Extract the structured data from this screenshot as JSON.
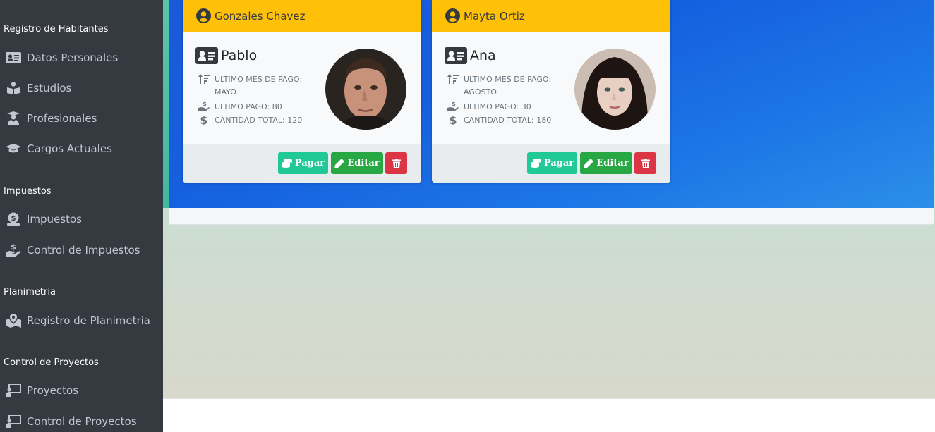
{
  "sidebar": {
    "sections": [
      {
        "header": "Registro de Habitantes",
        "items": [
          {
            "label": "Datos Personales",
            "icon": "id-card-icon"
          },
          {
            "label": "Estudios",
            "icon": "book-reader-icon"
          },
          {
            "label": "Profesionales",
            "icon": "user-graduate-icon"
          },
          {
            "label": "Cargos Actuales",
            "icon": "graduation-cap-icon"
          }
        ]
      },
      {
        "header": "Impuestos",
        "items": [
          {
            "label": "Impuestos",
            "icon": "search-dollar-icon"
          },
          {
            "label": "Control de Impuestos",
            "icon": "hand-holding-usd-icon"
          }
        ]
      },
      {
        "header": "Planimetria",
        "items": [
          {
            "label": "Registro de Planimetria",
            "icon": "map-marked-icon"
          }
        ]
      },
      {
        "header": "Control de Proyectos",
        "items": [
          {
            "label": "Proyectos",
            "icon": "chalkboard-teacher-icon"
          },
          {
            "label": "Control de Proyectos",
            "icon": "chalkboard-teacher-icon"
          }
        ]
      }
    ]
  },
  "cards": [
    {
      "surname": "Gonzales Chavez",
      "name": "Pablo",
      "last_month_label": "ULTIMO MES DE PAGO:",
      "last_month_value": "MAYO",
      "last_payment": "ULTIMO PAGO: 80",
      "total": "CANTIDAD TOTAL: 120",
      "pay_label": "Pagar",
      "edit_label": "Editar"
    },
    {
      "surname": "Mayta Ortiz",
      "name": "Ana",
      "last_month_label": "ULTIMO MES DE PAGO:",
      "last_month_value": "AGOSTO",
      "last_payment": "ULTIMO PAGO: 30",
      "total": "CANTIDAD TOTAL: 180",
      "pay_label": "Pagar",
      "edit_label": "Editar"
    }
  ],
  "colors": {
    "sidebar_bg": "#343a40",
    "card_header": "#ffc107",
    "pay_button": "#20c997",
    "edit_button": "#28a745",
    "delete_button": "#dc3545",
    "blue_panel": "#1560df"
  }
}
